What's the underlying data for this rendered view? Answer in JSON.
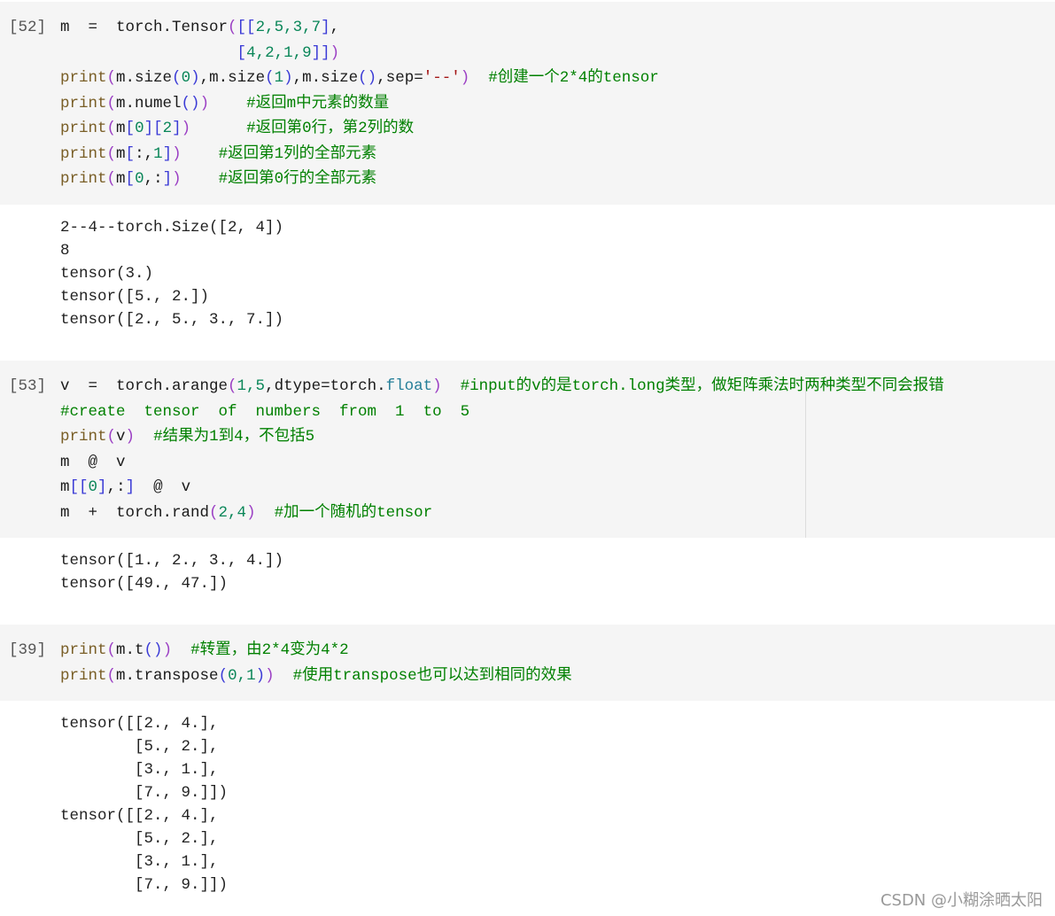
{
  "cells": [
    {
      "prompt": "[52]",
      "code": [
        [
          [
            "m  =  torch.Tensor",
            "t"
          ],
          [
            "(",
            "p"
          ],
          [
            "[[",
            "b"
          ],
          [
            "2,5,3,7",
            "n"
          ],
          [
            "]",
            "b"
          ],
          [
            ",",
            "t"
          ]
        ],
        [
          [
            "                   ",
            "t"
          ],
          [
            "[",
            "b"
          ],
          [
            "4,2,1,9",
            "n"
          ],
          [
            "]]",
            "b"
          ],
          [
            ")",
            "p"
          ]
        ],
        [
          [
            "print",
            "f"
          ],
          [
            "(",
            "p"
          ],
          [
            "m.size",
            "t"
          ],
          [
            "(",
            "b"
          ],
          [
            "0",
            "n"
          ],
          [
            ")",
            "b"
          ],
          [
            ",m.size",
            "t"
          ],
          [
            "(",
            "b"
          ],
          [
            "1",
            "n"
          ],
          [
            ")",
            "b"
          ],
          [
            ",m.size",
            "t"
          ],
          [
            "()",
            "b"
          ],
          [
            ",sep=",
            "t"
          ],
          [
            "'--'",
            "s"
          ],
          [
            ")",
            "p"
          ],
          [
            "  #创建一个2*4的tensor",
            "c"
          ]
        ],
        [
          [
            "print",
            "f"
          ],
          [
            "(",
            "p"
          ],
          [
            "m.numel",
            "t"
          ],
          [
            "()",
            "b"
          ],
          [
            ")",
            "p"
          ],
          [
            "    #返回m中元素的数量",
            "c"
          ]
        ],
        [
          [
            "print",
            "f"
          ],
          [
            "(",
            "p"
          ],
          [
            "m",
            "t"
          ],
          [
            "[",
            "b"
          ],
          [
            "0",
            "n"
          ],
          [
            "][",
            "b"
          ],
          [
            "2",
            "n"
          ],
          [
            "]",
            "b"
          ],
          [
            ")",
            "p"
          ],
          [
            "      #返回第0行，第2列的数",
            "c"
          ]
        ],
        [
          [
            "print",
            "f"
          ],
          [
            "(",
            "p"
          ],
          [
            "m",
            "t"
          ],
          [
            "[",
            "b"
          ],
          [
            ":,",
            "t"
          ],
          [
            "1",
            "n"
          ],
          [
            "]",
            "b"
          ],
          [
            ")",
            "p"
          ],
          [
            "    #返回第1列的全部元素",
            "c"
          ]
        ],
        [
          [
            "print",
            "f"
          ],
          [
            "(",
            "p"
          ],
          [
            "m",
            "t"
          ],
          [
            "[",
            "b"
          ],
          [
            "0",
            "n"
          ],
          [
            ",:",
            "t"
          ],
          [
            "]",
            "b"
          ],
          [
            ")",
            "p"
          ],
          [
            "    #返回第0行的全部元素",
            "c"
          ]
        ]
      ],
      "output": [
        "2--4--torch.Size([2, 4])",
        "8",
        "tensor(3.)",
        "tensor([5., 2.])",
        "tensor([2., 5., 3., 7.])"
      ]
    },
    {
      "prompt": "[53]",
      "code": [
        [
          [
            "v  =  torch.arange",
            "t"
          ],
          [
            "(",
            "p"
          ],
          [
            "1,5",
            "n"
          ],
          [
            ",dtype=torch.",
            "t"
          ],
          [
            "float",
            "k"
          ],
          [
            ")",
            "p"
          ],
          [
            "  #input的v的是torch.long类型，做矩阵乘法时两种类型不同会报错",
            "c"
          ]
        ],
        [
          [
            "#create  tensor  of  numbers  from  1  to  5",
            "c"
          ]
        ],
        [
          [
            "print",
            "f"
          ],
          [
            "(",
            "p"
          ],
          [
            "v",
            "t"
          ],
          [
            ")",
            "p"
          ],
          [
            "  #结果为1到4，不包括5",
            "c"
          ]
        ],
        [
          [
            "m  @  v",
            "t"
          ]
        ],
        [
          [
            "m",
            "t"
          ],
          [
            "[[",
            "b"
          ],
          [
            "0",
            "n"
          ],
          [
            "]",
            "b"
          ],
          [
            ",:",
            "t"
          ],
          [
            "]",
            "b"
          ],
          [
            "  @  v",
            "t"
          ]
        ],
        [
          [
            "m  +  torch.rand",
            "t"
          ],
          [
            "(",
            "p"
          ],
          [
            "2,4",
            "n"
          ],
          [
            ")",
            "p"
          ],
          [
            "  #加一个随机的tensor",
            "c"
          ]
        ]
      ],
      "output": [
        "tensor([1., 2., 3., 4.])",
        "tensor([49., 47.])"
      ]
    },
    {
      "prompt": "[39]",
      "code": [
        [
          [
            "print",
            "f"
          ],
          [
            "(",
            "p"
          ],
          [
            "m.t",
            "t"
          ],
          [
            "()",
            "b"
          ],
          [
            ")",
            "p"
          ],
          [
            "  #转置，由2*4变为4*2",
            "c"
          ]
        ],
        [
          [
            "print",
            "f"
          ],
          [
            "(",
            "p"
          ],
          [
            "m.transpose",
            "t"
          ],
          [
            "(",
            "b"
          ],
          [
            "0,1",
            "n"
          ],
          [
            ")",
            "b"
          ],
          [
            ")",
            "p"
          ],
          [
            "  #使用transpose也可以达到相同的效果",
            "c"
          ]
        ]
      ],
      "output": [
        "tensor([[2., 4.],",
        "        [5., 2.],",
        "        [3., 1.],",
        "        [7., 9.]])",
        "tensor([[2., 4.],",
        "        [5., 2.],",
        "        [3., 1.],",
        "        [7., 9.]])"
      ]
    }
  ],
  "watermark": "CSDN @小糊涂晒太阳"
}
